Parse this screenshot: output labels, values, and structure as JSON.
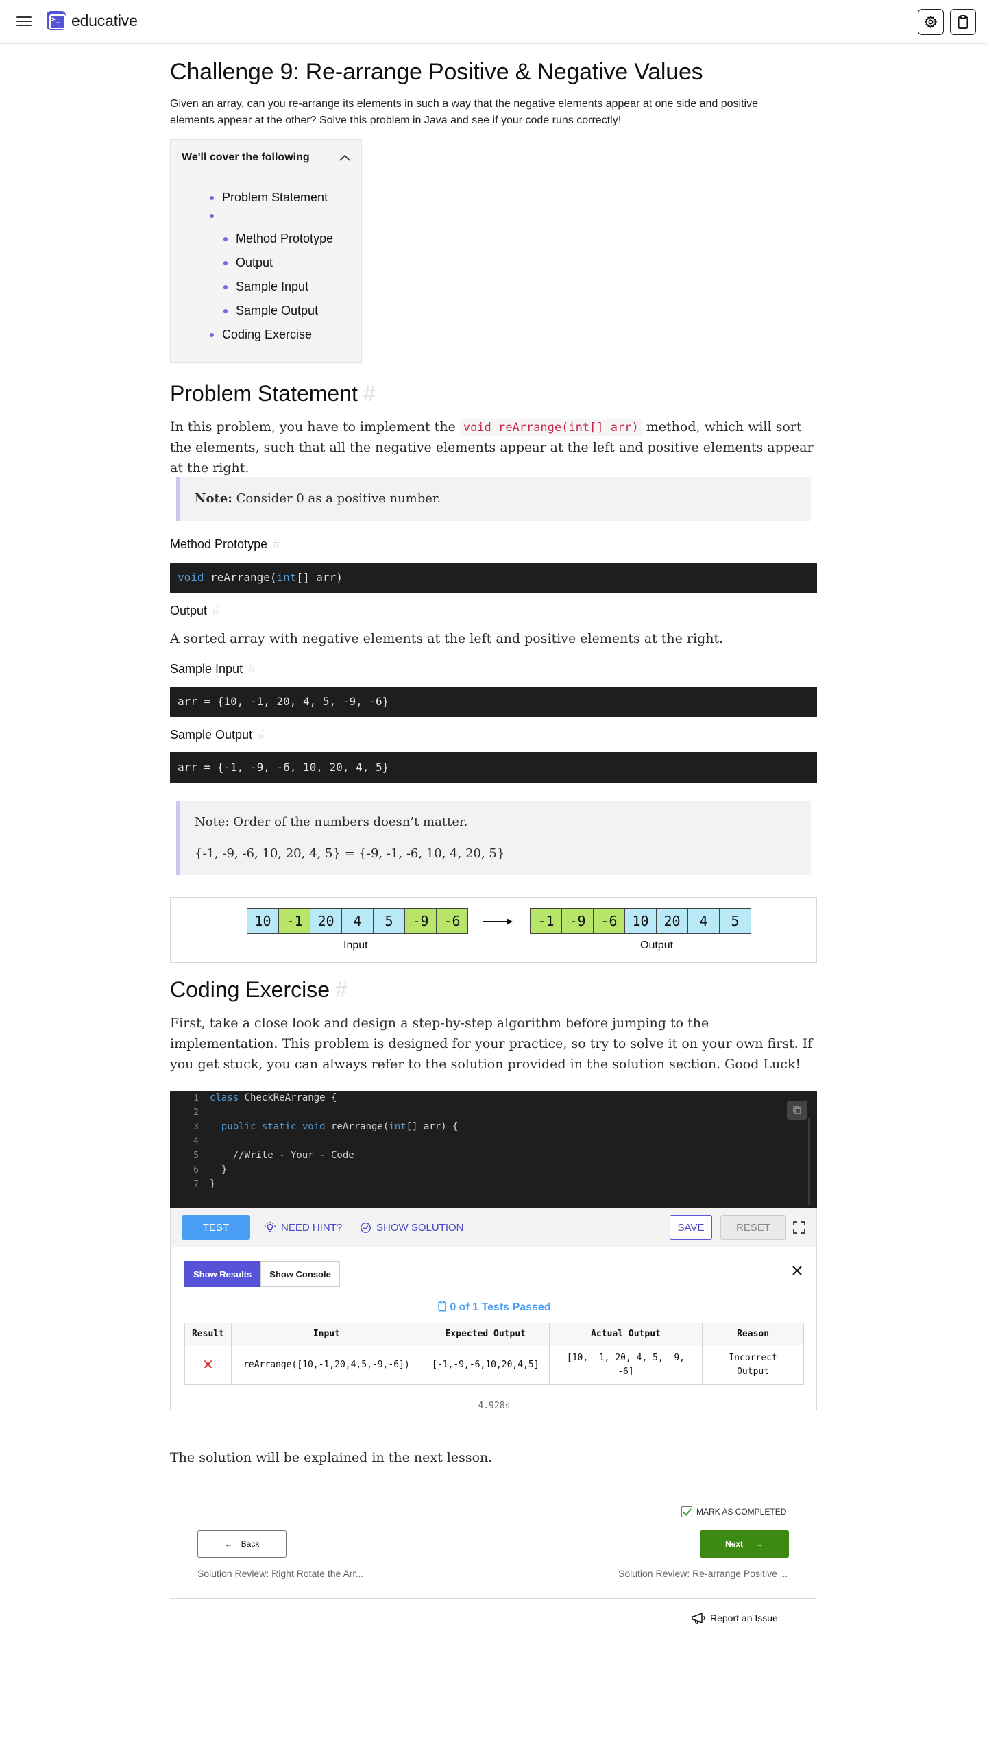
{
  "header": {
    "brand": "educative",
    "icons": {
      "menu": "hamburger-icon",
      "settings": "gear-icon",
      "clipboard": "clipboard-icon"
    }
  },
  "lesson": {
    "title": "Challenge 9: Re-arrange Positive & Negative Values",
    "description": "Given an array, can you re-arrange its elements in such a way that the negative elements appear at one side and positive elements appear at the other? Solve this problem in Java and see if your code runs correctly!"
  },
  "toc": {
    "heading": "We'll cover the following",
    "items": [
      "Problem Statement",
      "Coding Exercise"
    ],
    "subitems": [
      "Method Prototype",
      "Output",
      "Sample Input",
      "Sample Output"
    ]
  },
  "problem": {
    "heading": "Problem Statement",
    "hash": "#",
    "intro_before": "In this problem, you have to implement the ",
    "intro_code": "void reArrange(int[] arr)",
    "intro_after": " method, which will sort the elements, such that all the negative elements appear at the left and positive elements appear at the right.",
    "note_label": "Note:",
    "note_text": " Consider 0 as a positive number.",
    "method_heading": "Method Prototype",
    "method_code": {
      "kw1": "void",
      "mid": " reArrange(",
      "kw2": "int",
      "end": "[] arr)"
    },
    "output_heading": "Output",
    "output_text": "A sorted array with negative elements at the left and positive elements at the right.",
    "sample_input_heading": "Sample Input",
    "sample_input_code": "arr = {10, -1, 20, 4, 5, -9, -6}",
    "sample_output_heading": "Sample Output",
    "sample_output_code": "arr = {-1, -9, -6, 10, 20, 4, 5}",
    "note2_line1": "Note: Order of the numbers doesn’t matter.",
    "note2_line2": "{-1, -9, -6, 10, 20, 4, 5} = {-9, -1, -6, 10, 4, 20, 5}"
  },
  "diagram": {
    "input": [
      "10",
      "-1",
      "20",
      "4",
      "5",
      "-9",
      "-6"
    ],
    "output": [
      "-1",
      "-9",
      "-6",
      "10",
      "20",
      "4",
      "5"
    ],
    "input_label": "Input",
    "output_label": "Output",
    "colors": {
      "positive": "#b9e8f6",
      "negative": "#b7e56a"
    }
  },
  "exercise": {
    "heading": "Coding Exercise",
    "text": "First, take a close look and design a step-by-step algorithm before jumping to the implementation. This problem is designed for your practice, so try to solve it on your own first. If you get stuck, you can always refer to the solution provided in the solution section. Good Luck!",
    "line_numbers": [
      "1",
      "2",
      "3",
      "4",
      "5",
      "6",
      "7"
    ],
    "code": {
      "l1_kw": "class",
      "l1_rest": " CheckReArrange {",
      "l3_indent": "  ",
      "l3_kw": "public static void",
      "l3_mid": " reArrange(",
      "l3_kw2": "int",
      "l3_end": "[] arr) {",
      "l5": "    //Write - Your - Code",
      "l6": "  }",
      "l7": "}"
    }
  },
  "toolbar": {
    "test": "TEST",
    "hint": "NEED HINT?",
    "solution": "SHOW SOLUTION",
    "save": "SAVE",
    "reset": "RESET"
  },
  "results": {
    "tab_results": "Show Results",
    "tab_console": "Show Console",
    "summary": "0 of 1 Tests Passed",
    "columns": [
      "Result",
      "Input",
      "Expected Output",
      "Actual Output",
      "Reason"
    ],
    "rows": [
      {
        "result": "✕",
        "input": "reArrange([10,-1,20,4,5,-9,-6])",
        "expected": "[-1,-9,-6,10,20,4,5]",
        "actual_line1": "[10, -1, 20, 4, 5, -9,",
        "actual_line2": "-6]",
        "reason_line1": "Incorrect",
        "reason_line2": "Output"
      }
    ],
    "timing": "4.928s"
  },
  "closing_text": "The solution will be explained in the next lesson.",
  "navigation": {
    "mark_completed": "MARK AS COMPLETED",
    "back": "Back",
    "next": "Next",
    "prev_caption": "Solution Review: Right Rotate the Arr...",
    "next_caption": "Solution Review: Re-arrange Positive ...",
    "report": "Report an Issue"
  },
  "colors": {
    "accent": "#5653d9",
    "test_button": "#4a9ff5",
    "next_button": "#3c8a12",
    "fail": "#e03131"
  }
}
